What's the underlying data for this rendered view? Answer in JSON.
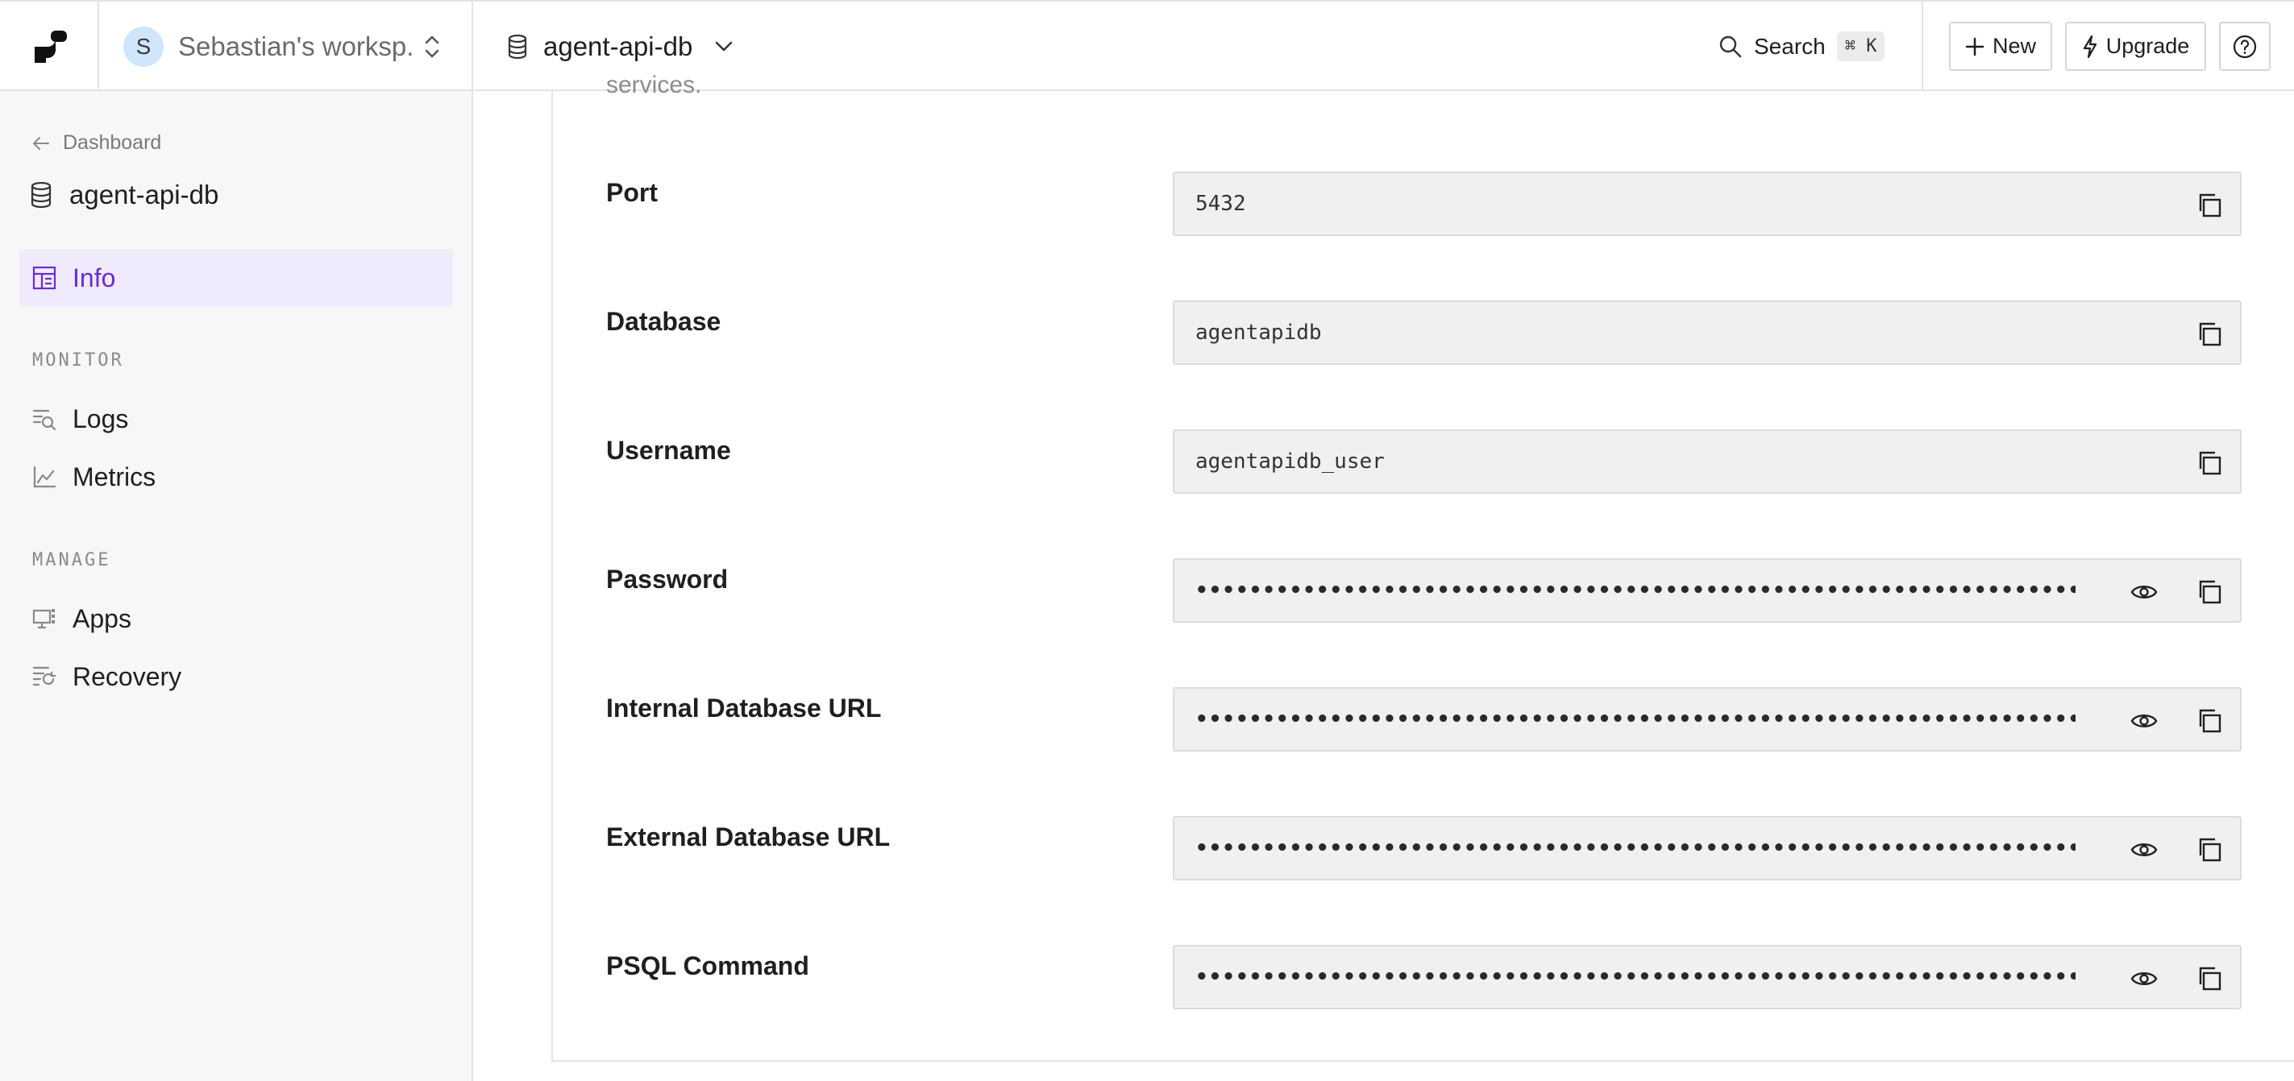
{
  "topbar": {
    "workspace_initial": "S",
    "workspace_name": "Sebastian's worksp...",
    "db_name": "agent-api-db",
    "search_label": "Search",
    "search_shortcut": "⌘ K",
    "new_label": "New",
    "upgrade_label": "Upgrade"
  },
  "sidebar": {
    "back_label": "Dashboard",
    "db_name": "agent-api-db",
    "info_label": "Info",
    "monitor_section": "MONITOR",
    "logs_label": "Logs",
    "metrics_label": "Metrics",
    "manage_section": "MANAGE",
    "apps_label": "Apps",
    "recovery_label": "Recovery"
  },
  "main": {
    "cut_text": "services.",
    "rows": [
      {
        "label": "Port",
        "value": "5432",
        "masked": false
      },
      {
        "label": "Database",
        "value": "agentapidb",
        "masked": false
      },
      {
        "label": "Username",
        "value": "agentapidb_user",
        "masked": false
      },
      {
        "label": "Password",
        "value": "•••••••••••••••••••••••••••••••••••••••••••••••••••••••••••••••••••••••••…",
        "masked": true
      },
      {
        "label": "Internal Database URL",
        "value": "•••••••••••••••••••••••••••••••••••••••••••••••••••••••••••••••••••••••••…",
        "masked": true
      },
      {
        "label": "External Database URL",
        "value": "•••••••••••••••••••••••••••••••••••••••••••••••••••••••••••••••••••••••••…",
        "masked": true
      },
      {
        "label": "PSQL Command",
        "value": "•••••••••••••••••••••••••••••••••••••••••••••••••••••••••••••••••••••••••…",
        "masked": true
      }
    ]
  },
  "colors": {
    "accent": "#6b2bd1",
    "active_bg": "#efeafc",
    "avatar_bg": "#cfe6fb"
  }
}
